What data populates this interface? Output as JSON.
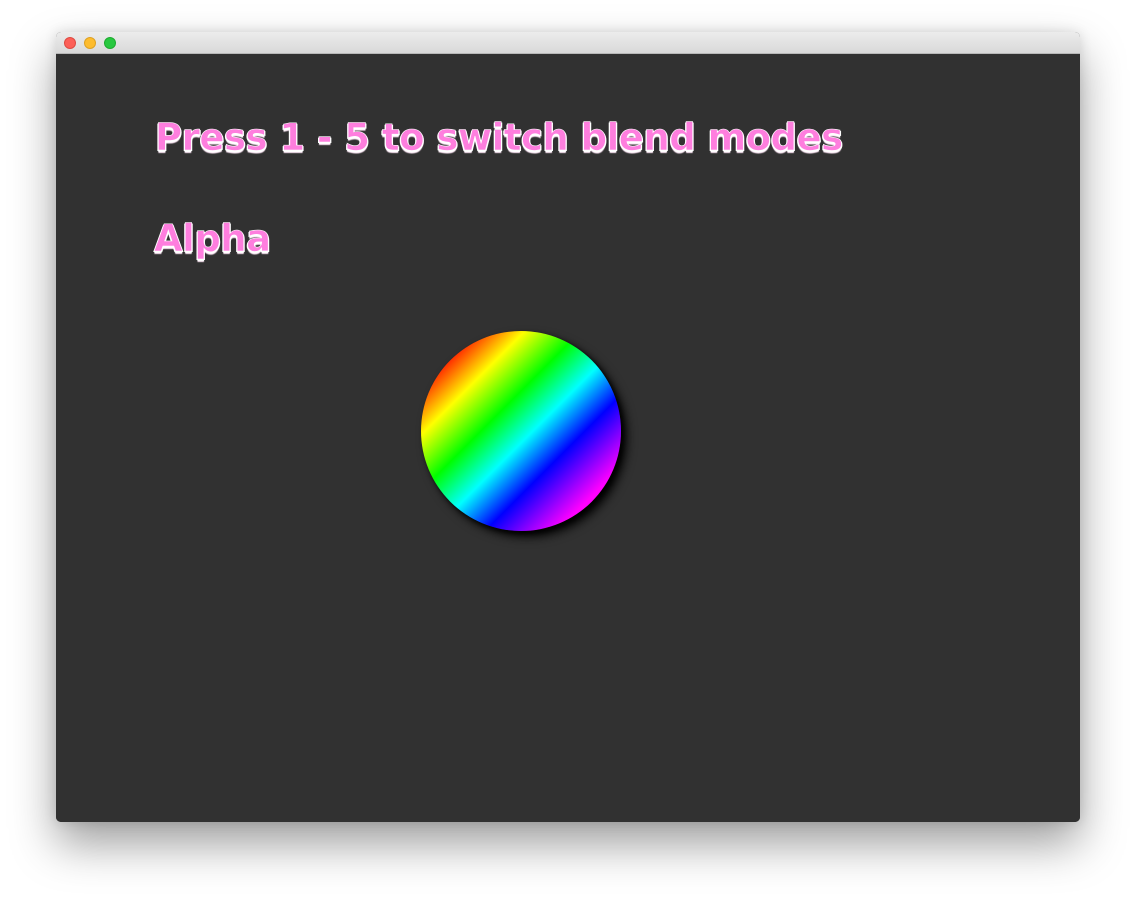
{
  "window": {
    "title": "",
    "traffic_lights": [
      "close",
      "minimize",
      "zoom"
    ]
  },
  "canvas": {
    "instructions": "Press 1 - 5 to switch blend modes",
    "blend_mode": "Alpha",
    "text_color": "#fe7ede",
    "background_color": "#313131",
    "orb_icon": "rainbow-gradient-circle"
  }
}
